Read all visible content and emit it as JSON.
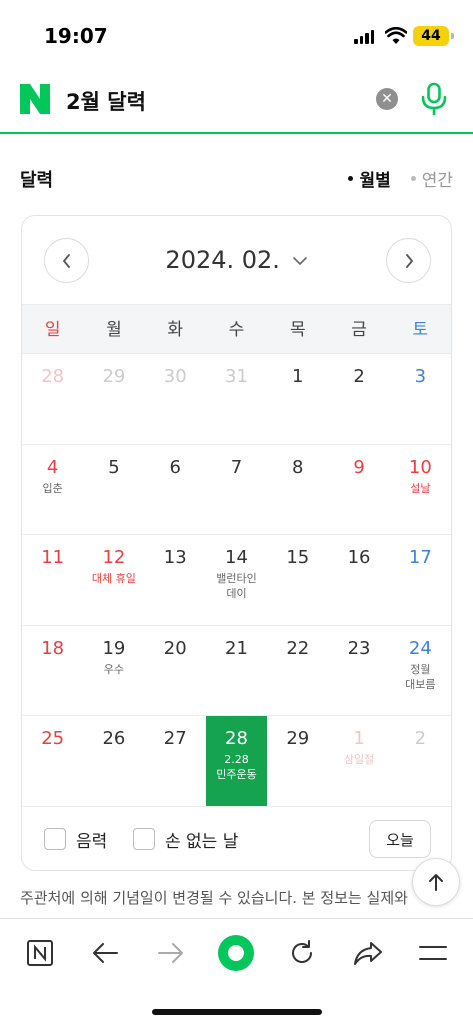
{
  "status": {
    "time": "19:07",
    "battery": "44"
  },
  "search": {
    "query": "2월 달력",
    "clear_icon": "close-circle-icon",
    "mic_icon": "microphone-icon",
    "accent": "#03c75a"
  },
  "section": {
    "title": "달력",
    "tabs": [
      {
        "label": "월별",
        "active": true
      },
      {
        "label": "연간",
        "active": false
      }
    ]
  },
  "calendar": {
    "month_label": "2024. 02.",
    "weekdays": [
      "일",
      "월",
      "화",
      "수",
      "목",
      "금",
      "토"
    ],
    "weeks": [
      [
        {
          "n": "28",
          "note": "",
          "type": "other sun"
        },
        {
          "n": "29",
          "note": "",
          "type": "other"
        },
        {
          "n": "30",
          "note": "",
          "type": "other"
        },
        {
          "n": "31",
          "note": "",
          "type": "other"
        },
        {
          "n": "1",
          "note": "",
          "type": ""
        },
        {
          "n": "2",
          "note": "",
          "type": ""
        },
        {
          "n": "3",
          "note": "",
          "type": "sat"
        }
      ],
      [
        {
          "n": "4",
          "note": "입춘",
          "type": "sun"
        },
        {
          "n": "5",
          "note": "",
          "type": ""
        },
        {
          "n": "6",
          "note": "",
          "type": ""
        },
        {
          "n": "7",
          "note": "",
          "type": ""
        },
        {
          "n": "8",
          "note": "",
          "type": ""
        },
        {
          "n": "9",
          "note": "",
          "type": "holiday"
        },
        {
          "n": "10",
          "note": "설날",
          "type": "holiday"
        }
      ],
      [
        {
          "n": "11",
          "note": "",
          "type": "sun"
        },
        {
          "n": "12",
          "note": "대체 휴일",
          "type": "holiday"
        },
        {
          "n": "13",
          "note": "",
          "type": ""
        },
        {
          "n": "14",
          "note": "밸런타인\n데이",
          "type": ""
        },
        {
          "n": "15",
          "note": "",
          "type": ""
        },
        {
          "n": "16",
          "note": "",
          "type": ""
        },
        {
          "n": "17",
          "note": "",
          "type": "sat"
        }
      ],
      [
        {
          "n": "18",
          "note": "",
          "type": "sun"
        },
        {
          "n": "19",
          "note": "우수",
          "type": ""
        },
        {
          "n": "20",
          "note": "",
          "type": ""
        },
        {
          "n": "21",
          "note": "",
          "type": ""
        },
        {
          "n": "22",
          "note": "",
          "type": ""
        },
        {
          "n": "23",
          "note": "",
          "type": ""
        },
        {
          "n": "24",
          "note": "정월\n대보름",
          "type": "sat"
        }
      ],
      [
        {
          "n": "25",
          "note": "",
          "type": "sun"
        },
        {
          "n": "26",
          "note": "",
          "type": ""
        },
        {
          "n": "27",
          "note": "",
          "type": ""
        },
        {
          "n": "28",
          "note": "2.28\n민주운동",
          "type": "today"
        },
        {
          "n": "29",
          "note": "",
          "type": ""
        },
        {
          "n": "1",
          "note": "삼일절",
          "type": "other holiday-other"
        },
        {
          "n": "2",
          "note": "",
          "type": "other"
        }
      ]
    ],
    "colors": {
      "sunday": "#f03c3c",
      "saturday": "#3b82e0",
      "today_bg": "#16a34f"
    },
    "options": {
      "lunar": "음력",
      "no_holiday": "손 없는 날"
    },
    "today_button": "오늘"
  },
  "notice": "주관처에 의해 기념일이 변경될 수 있습니다. 본 정보는 실제와",
  "toolbar": {
    "icons": [
      "naver-home-icon",
      "back-icon",
      "forward-icon",
      "green-dot-icon",
      "reload-icon",
      "share-icon",
      "menu-icon"
    ]
  }
}
